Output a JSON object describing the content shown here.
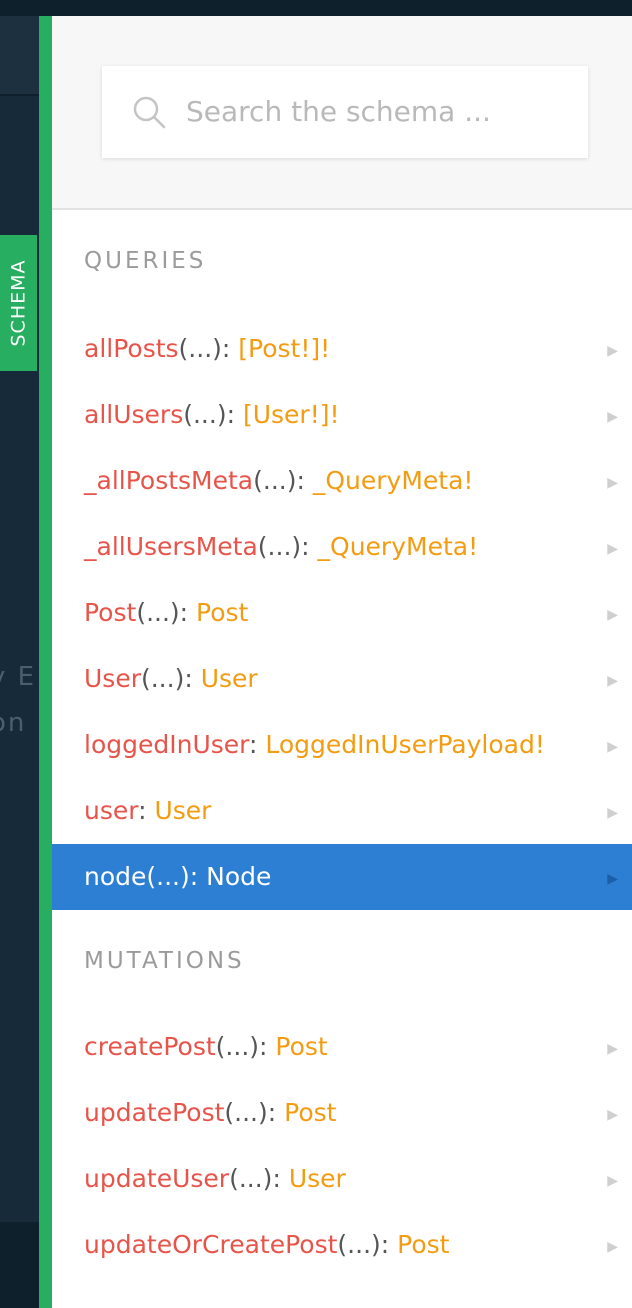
{
  "left_panel": {
    "tab_label": "SCHEMA",
    "partial_text_1": "y E",
    "partial_text_2": "on"
  },
  "search": {
    "placeholder": "Search the schema ..."
  },
  "queries": {
    "title": "QUERIES",
    "fields": [
      {
        "name": "allPosts",
        "args": "(...)",
        "colon": ": ",
        "type": "[Post!]!"
      },
      {
        "name": "allUsers",
        "args": "(...)",
        "colon": ": ",
        "type": "[User!]!"
      },
      {
        "name": "_allPostsMeta",
        "args": "(...)",
        "colon": ": ",
        "type": "_QueryMeta!"
      },
      {
        "name": "_allUsersMeta",
        "args": "(...)",
        "colon": ": ",
        "type": "_QueryMeta!"
      },
      {
        "name": "Post",
        "args": "(...)",
        "colon": ": ",
        "type": "Post"
      },
      {
        "name": "User",
        "args": "(...)",
        "colon": ": ",
        "type": "User"
      },
      {
        "name": "loggedInUser",
        "args": "",
        "colon": ": ",
        "type": "LoggedInUserPayload!"
      },
      {
        "name": "user",
        "args": "",
        "colon": ": ",
        "type": "User"
      },
      {
        "name": "node",
        "args": "(...)",
        "colon": ": ",
        "type": "Node",
        "selected": true
      }
    ]
  },
  "mutations": {
    "title": "MUTATIONS",
    "fields": [
      {
        "name": "createPost",
        "args": "(...)",
        "colon": ": ",
        "type": "Post"
      },
      {
        "name": "updatePost",
        "args": "(...)",
        "colon": ": ",
        "type": "Post"
      },
      {
        "name": "updateUser",
        "args": "(...)",
        "colon": ": ",
        "type": "User"
      },
      {
        "name": "updateOrCreatePost",
        "args": "(...)",
        "colon": ": ",
        "type": "Post"
      }
    ]
  },
  "icons": {
    "search": "search-icon",
    "row_arrow": "triangle-right-icon"
  },
  "colors": {
    "accent_green": "#27ae60",
    "selected_blue": "#2d7fd3",
    "field_name": "#e7544a",
    "field_type": "#f39c12"
  }
}
